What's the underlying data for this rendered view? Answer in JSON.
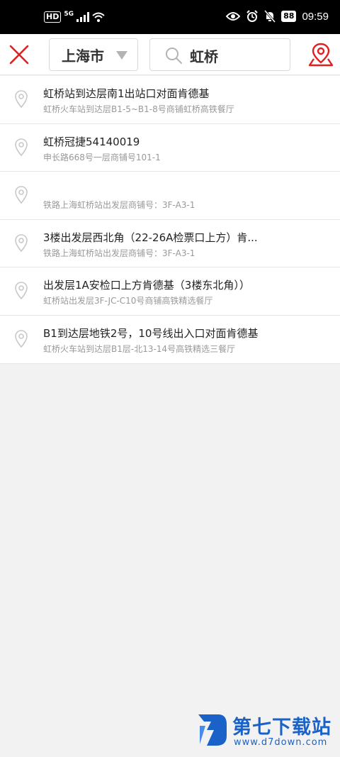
{
  "status_bar": {
    "hd": "HD",
    "network": "5G",
    "battery": "88",
    "time": "09:59"
  },
  "header": {
    "city": "上海市",
    "search_value": "虹桥",
    "icons": {
      "close": "close-icon",
      "city_dropdown": "triangle-down-icon",
      "search": "search-icon",
      "map": "map-pin-icon"
    },
    "accent_color": "#e02020"
  },
  "results": [
    {
      "title": "虹桥站到达层南1出站口对面肯德基",
      "subtitle": "虹桥火车站到达层B1-5~B1-8号商铺虹桥高铁餐厅"
    },
    {
      "title": "虹桥冠捷54140019",
      "subtitle": "申长路668号一层商铺号101-1"
    },
    {
      "title": "",
      "subtitle": "铁路上海虹桥站出发层商铺号：3F-A3-1"
    },
    {
      "title": "3楼出发层西北角（22-26A检票口上方）肯...",
      "subtitle": "铁路上海虹桥站出发层商铺号：3F-A3-1"
    },
    {
      "title": "出发层1A安检口上方肯德基（3楼东北角））",
      "subtitle": "虹桥站出发层3F-JC-C10号商铺高铁精选餐厅"
    },
    {
      "title": "B1到达层地铁2号，10号线出入口对面肯德基",
      "subtitle": "虹桥火车站到达层B1层-北13-14号高铁精选三餐厅"
    }
  ],
  "watermark": {
    "title": "第七下载站",
    "url": "www.d7down.com",
    "color": "#1b62c8"
  }
}
